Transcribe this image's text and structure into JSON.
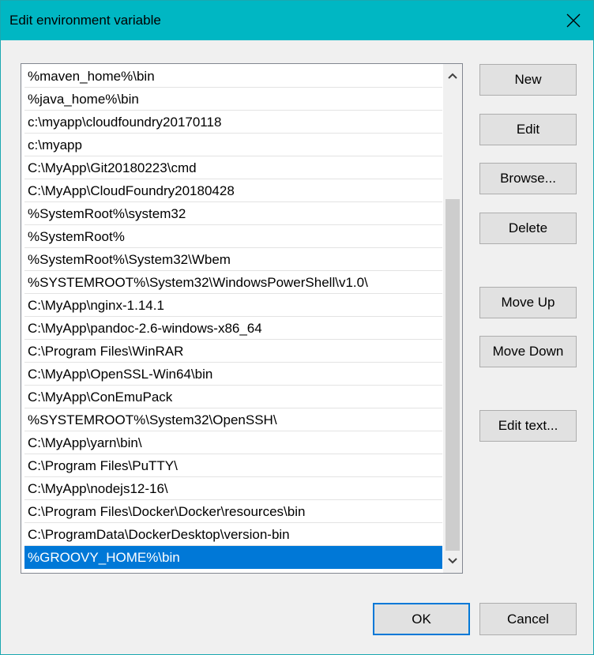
{
  "window": {
    "title": "Edit environment variable",
    "close_icon": "close-icon"
  },
  "list": {
    "items": [
      "%maven_home%\\bin",
      "%java_home%\\bin",
      "c:\\myapp\\cloudfoundry20170118",
      "c:\\myapp",
      "C:\\MyApp\\Git20180223\\cmd",
      "C:\\MyApp\\CloudFoundry20180428",
      "%SystemRoot%\\system32",
      "%SystemRoot%",
      "%SystemRoot%\\System32\\Wbem",
      "%SYSTEMROOT%\\System32\\WindowsPowerShell\\v1.0\\",
      "C:\\MyApp\\nginx-1.14.1",
      "C:\\MyApp\\pandoc-2.6-windows-x86_64",
      "C:\\Program Files\\WinRAR",
      "C:\\MyApp\\OpenSSL-Win64\\bin",
      "C:\\MyApp\\ConEmuPack",
      "%SYSTEMROOT%\\System32\\OpenSSH\\",
      "C:\\MyApp\\yarn\\bin\\",
      "C:\\Program Files\\PuTTY\\",
      "C:\\MyApp\\nodejs12-16\\",
      "C:\\Program Files\\Docker\\Docker\\resources\\bin",
      "C:\\ProgramData\\DockerDesktop\\version-bin",
      "%GROOVY_HOME%\\bin"
    ],
    "selected_index": 21
  },
  "buttons": {
    "new": "New",
    "edit": "Edit",
    "browse": "Browse...",
    "delete": "Delete",
    "move_up": "Move Up",
    "move_down": "Move Down",
    "edit_text": "Edit text...",
    "ok": "OK",
    "cancel": "Cancel"
  },
  "colors": {
    "titlebar": "#00b7c3",
    "selection": "#0078d7",
    "default_button_border": "#0078d7",
    "dialog_background": "#f0f0f0"
  }
}
